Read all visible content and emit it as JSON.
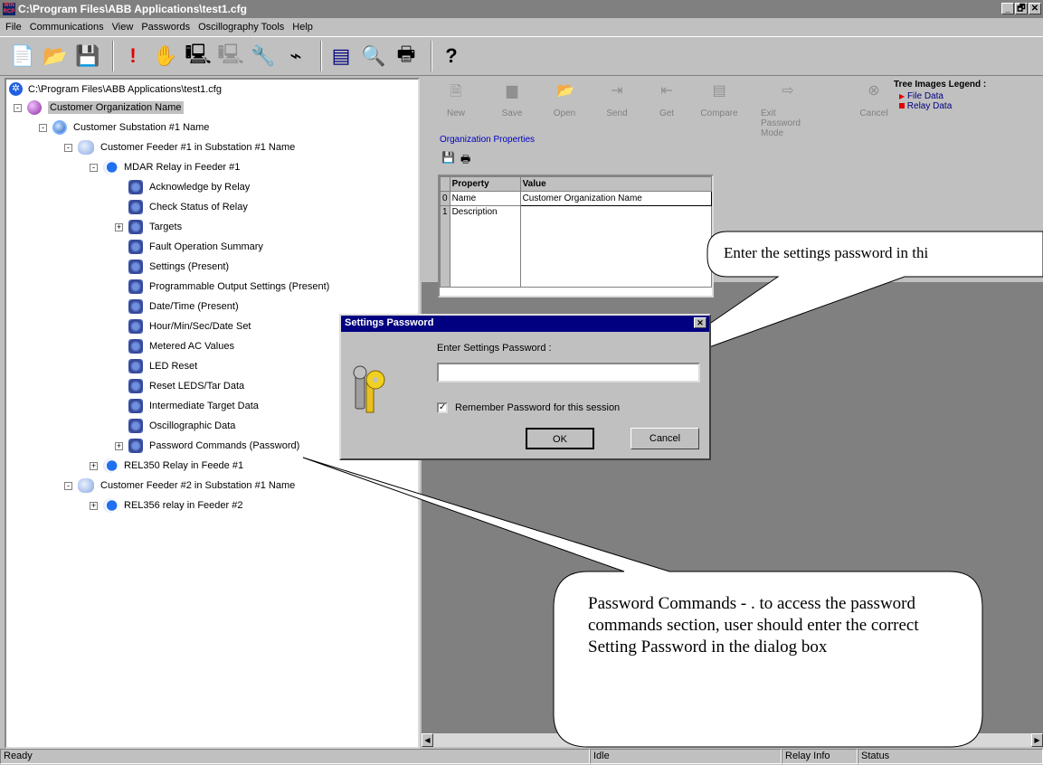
{
  "window": {
    "app_icon": "WIN\nRCP",
    "title": "C:\\Program Files\\ABB Applications\\test1.cfg",
    "controls": [
      "_",
      "🗗",
      "✕"
    ]
  },
  "menu": [
    "File",
    "Communications",
    "View",
    "Passwords",
    "Oscillography Tools",
    "Help"
  ],
  "toolbar": {
    "icons": [
      "new-file-icon",
      "open-folder-icon",
      "save-disk-icon",
      "exclamation-icon",
      "hand-icon",
      "computer-icon",
      "computer-disabled-icon",
      "wrench-icon",
      "cable-icon",
      "form-icon",
      "zoom-icon",
      "printer-icon",
      "help-icon"
    ]
  },
  "tree": {
    "root_path": "C:\\Program Files\\ABB Applications\\test1.cfg",
    "nodes": [
      {
        "label": "Customer Organization Name",
        "level": 0,
        "type": "org",
        "exp": "-",
        "selected": true
      },
      {
        "label": "Customer Substation #1 Name",
        "level": 1,
        "type": "sub",
        "exp": "-"
      },
      {
        "label": "Customer Feeder #1 in Substation #1 Name",
        "level": 2,
        "type": "feeder",
        "exp": "-"
      },
      {
        "label": "MDAR Relay in Feeder #1",
        "level": 3,
        "type": "relay",
        "exp": "-"
      },
      {
        "label": "Acknowledge by Relay",
        "level": 4,
        "type": "item",
        "exp": ""
      },
      {
        "label": "Check Status of Relay",
        "level": 4,
        "type": "item",
        "exp": ""
      },
      {
        "label": "Targets",
        "level": 4,
        "type": "item",
        "exp": "+"
      },
      {
        "label": "Fault Operation Summary",
        "level": 4,
        "type": "item",
        "exp": ""
      },
      {
        "label": "Settings (Present)",
        "level": 4,
        "type": "item",
        "exp": ""
      },
      {
        "label": "Programmable Output Settings (Present)",
        "level": 4,
        "type": "item",
        "exp": ""
      },
      {
        "label": "Date/Time (Present)",
        "level": 4,
        "type": "item",
        "exp": ""
      },
      {
        "label": "Hour/Min/Sec/Date Set",
        "level": 4,
        "type": "item",
        "exp": ""
      },
      {
        "label": "Metered AC Values",
        "level": 4,
        "type": "item",
        "exp": ""
      },
      {
        "label": "LED Reset",
        "level": 4,
        "type": "item",
        "exp": ""
      },
      {
        "label": "Reset LEDS/Tar Data",
        "level": 4,
        "type": "item",
        "exp": ""
      },
      {
        "label": "Intermediate Target Data",
        "level": 4,
        "type": "item",
        "exp": ""
      },
      {
        "label": "Oscillographic Data",
        "level": 4,
        "type": "item",
        "exp": ""
      },
      {
        "label": "Password Commands (Password)",
        "level": 4,
        "type": "item",
        "exp": "+"
      },
      {
        "label": "REL350 Relay in Feede #1",
        "level": 3,
        "type": "relay",
        "exp": "+"
      },
      {
        "label": "Customer Feeder #2 in Substation #1 Name",
        "level": 2,
        "type": "feeder",
        "exp": "-"
      },
      {
        "label": "REL356 relay in Feeder #2",
        "level": 3,
        "type": "relay",
        "exp": "+"
      }
    ]
  },
  "actions": [
    {
      "label": "New",
      "icon": "new-icon",
      "glyph": "🗎"
    },
    {
      "label": "Save",
      "icon": "save-icon",
      "glyph": "▆"
    },
    {
      "label": "Open",
      "icon": "open-icon",
      "glyph": "📂"
    },
    {
      "label": "Send",
      "icon": "send-icon",
      "glyph": "⇥"
    },
    {
      "label": "Get",
      "icon": "get-icon",
      "glyph": "⇤"
    },
    {
      "label": "Compare",
      "icon": "compare-icon",
      "glyph": "▤"
    },
    {
      "label": "Exit Password Mode",
      "icon": "exit-password-icon",
      "glyph": "⇨"
    },
    {
      "label": "Cancel",
      "icon": "cancel-icon",
      "glyph": "⊗"
    }
  ],
  "org_properties": {
    "link": "Organization Properties",
    "columns": [
      "Property",
      "Value"
    ],
    "rows": [
      {
        "index": "0",
        "property": "Name",
        "value": "Customer Organization Name"
      },
      {
        "index": "1",
        "property": "Description",
        "value": ""
      }
    ]
  },
  "legend": {
    "title": "Tree Images Legend :",
    "items": [
      "File Data",
      "Relay Data"
    ],
    "colors": [
      "#e00000",
      "#e00000"
    ]
  },
  "dialog": {
    "title": "Settings Password",
    "prompt": "Enter Settings Password :",
    "password_value": "",
    "remember_label": "Remember Password for this session",
    "remember_checked": "✓",
    "ok_label": "OK",
    "cancel_label": "Cancel"
  },
  "callouts": {
    "top": "Enter the settings password in thi",
    "bottom": "Password Commands - . to access the password commands section, user should enter the correct Setting Password in the dialog box"
  },
  "status": {
    "left": "Ready",
    "middle": "Idle",
    "relay": "Relay Info",
    "status": "Status"
  }
}
